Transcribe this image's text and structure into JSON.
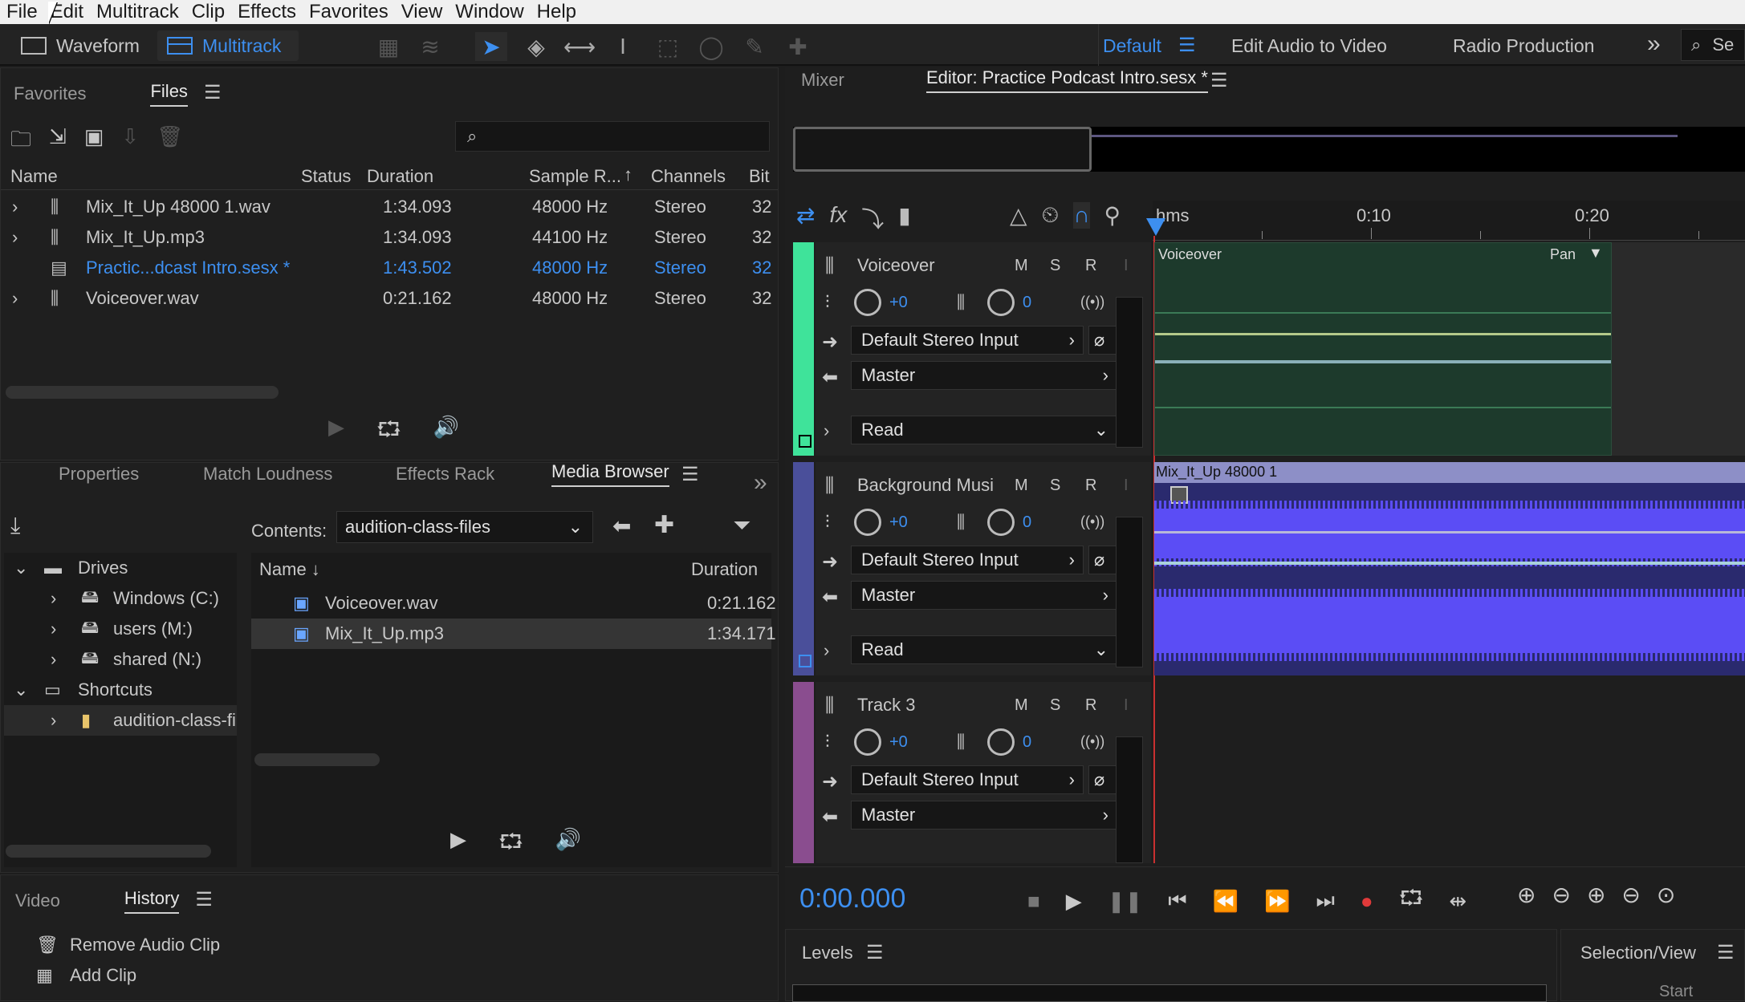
{
  "menu": [
    "File",
    "Edit",
    "Multitrack",
    "Clip",
    "Effects",
    "Favorites",
    "View",
    "Window",
    "Help"
  ],
  "workspace": {
    "waveform": "Waveform",
    "multitrack": "Multitrack",
    "default": "Default",
    "edit_audio_video": "Edit Audio to Video",
    "radio": "Radio Production",
    "search_placeholder": "Se"
  },
  "files_panel": {
    "tabs": {
      "favorites": "Favorites",
      "files": "Files"
    },
    "columns": {
      "name": "Name",
      "status": "Status",
      "duration": "Duration",
      "sample_rate": "Sample R...",
      "channels": "Channels",
      "bit": "Bit"
    },
    "rows": [
      {
        "name": "Mix_It_Up 48000 1.wav",
        "duration": "1:34.093",
        "rate": "48000 Hz",
        "channels": "Stereo",
        "bit": "32"
      },
      {
        "name": "Mix_It_Up.mp3",
        "duration": "1:34.093",
        "rate": "44100 Hz",
        "channels": "Stereo",
        "bit": "32"
      },
      {
        "name": "Practic...dcast Intro.sesx *",
        "duration": "1:43.502",
        "rate": "48000 Hz",
        "channels": "Stereo",
        "bit": "32"
      },
      {
        "name": "Voiceover.wav",
        "duration": "0:21.162",
        "rate": "48000 Hz",
        "channels": "Stereo",
        "bit": "32"
      }
    ]
  },
  "media_panel": {
    "tabs": {
      "properties": "Properties",
      "match": "Match Loudness",
      "effects": "Effects Rack",
      "media": "Media Browser"
    },
    "contents_label": "Contents:",
    "contents_value": "audition-class-files",
    "tree": {
      "drives": "Drives",
      "windows": "Windows (C:)",
      "users": "users (M:)",
      "shared": "shared (N:)",
      "shortcuts": "Shortcuts",
      "folder": "audition-class-fi"
    },
    "list_cols": {
      "name": "Name",
      "duration": "Duration"
    },
    "list": [
      {
        "name": "Voiceover.wav",
        "duration": "0:21.162"
      },
      {
        "name": "Mix_It_Up.mp3",
        "duration": "1:34.171"
      }
    ]
  },
  "history_panel": {
    "tabs": {
      "video": "Video",
      "history": "History"
    },
    "items": [
      "Remove Audio Clip",
      "Add Clip"
    ]
  },
  "editor": {
    "tabs": {
      "mixer": "Mixer",
      "editor": "Editor: Practice Podcast Intro.sesx *"
    },
    "ruler": {
      "unit": "hms",
      "t1": "0:10",
      "t2": "0:20"
    },
    "time": "0:00.000",
    "tracks": [
      {
        "name": "Voiceover",
        "vol": "+0",
        "pan": "0",
        "input": "Default Stereo Input",
        "output": "Master",
        "mode": "Read",
        "color": "#3fe39a",
        "clip": "Voiceover",
        "clip_pan": "Pan"
      },
      {
        "name": "Background Musi",
        "vol": "+0",
        "pan": "0",
        "input": "Default Stereo Input",
        "output": "Master",
        "mode": "Read",
        "color": "#4a4f9a",
        "clip": "Mix_It_Up 48000 1"
      },
      {
        "name": "Track 3",
        "vol": "+0",
        "pan": "0",
        "input": "Default Stereo Input",
        "output": "Master",
        "color": "#8a4d8f"
      }
    ],
    "msr": {
      "m": "M",
      "s": "S",
      "r": "R"
    }
  },
  "levels": {
    "title": "Levels"
  },
  "selection": {
    "title": "Selection/View",
    "start": "Start"
  },
  "colors": {
    "accent": "#3d8ff0",
    "waveform": "#5b4df5",
    "record": "#e03a3a"
  }
}
